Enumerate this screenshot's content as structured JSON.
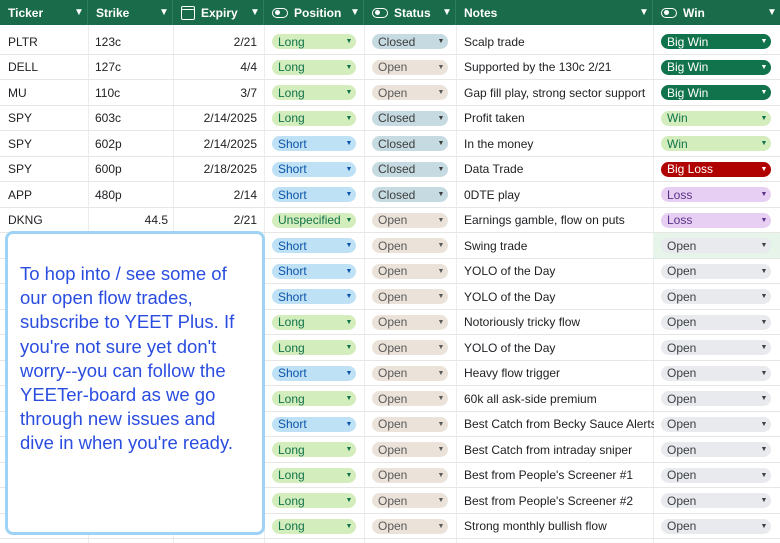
{
  "columns": [
    {
      "label": "Ticker"
    },
    {
      "label": "Strike"
    },
    {
      "label": "Expiry"
    },
    {
      "label": "Position"
    },
    {
      "label": "Status"
    },
    {
      "label": "Notes"
    },
    {
      "label": "Win"
    }
  ],
  "rows": [
    {
      "ticker": "PLTR",
      "strike": "123c",
      "mid": "",
      "expiry": "2/21",
      "position": "Long",
      "status": "Closed",
      "notes": "Scalp trade",
      "win": "Big Win"
    },
    {
      "ticker": "DELL",
      "strike": "127c",
      "mid": "",
      "expiry": "4/4",
      "position": "Long",
      "status": "Open",
      "notes": "Supported by the 130c 2/21",
      "win": "Big Win"
    },
    {
      "ticker": "MU",
      "strike": "110c",
      "mid": "",
      "expiry": "3/7",
      "position": "Long",
      "status": "Open",
      "notes": "Gap fill play, strong sector support",
      "win": "Big Win"
    },
    {
      "ticker": "SPY",
      "strike": "603c",
      "mid": "",
      "expiry": "2/14/2025",
      "position": "Long",
      "status": "Closed",
      "notes": "Profit taken",
      "win": "Win"
    },
    {
      "ticker": "SPY",
      "strike": "602p",
      "mid": "",
      "expiry": "2/14/2025",
      "position": "Short",
      "status": "Closed",
      "notes": "In the money",
      "win": "Win"
    },
    {
      "ticker": "SPY",
      "strike": "600p",
      "mid": "",
      "expiry": "2/18/2025",
      "position": "Short",
      "status": "Closed",
      "notes": "Data Trade",
      "win": "Big Loss"
    },
    {
      "ticker": "APP",
      "strike": "480p",
      "mid": "",
      "expiry": "2/14",
      "position": "Short",
      "status": "Closed",
      "notes": "0DTE  play",
      "win": "Loss"
    },
    {
      "ticker": "DKNG",
      "strike": "",
      "mid": "44.5",
      "expiry": "2/21",
      "position": "Unspecified",
      "status": "Open",
      "notes": "Earnings gamble, flow on puts",
      "win": "Loss"
    },
    {
      "ticker": "",
      "strike": "",
      "mid": "",
      "expiry": "",
      "position": "Short",
      "status": "Open",
      "notes": "Swing trade",
      "win": "Open"
    },
    {
      "ticker": "",
      "strike": "",
      "mid": "",
      "expiry": "",
      "position": "Short",
      "status": "Open",
      "notes": "YOLO of the Day",
      "win": "Open"
    },
    {
      "ticker": "",
      "strike": "",
      "mid": "",
      "expiry": "",
      "position": "Short",
      "status": "Open",
      "notes": "YOLO of the Day",
      "win": "Open"
    },
    {
      "ticker": "",
      "strike": "",
      "mid": "",
      "expiry": "",
      "position": "Long",
      "status": "Open",
      "notes": "Notoriously tricky flow",
      "win": "Open"
    },
    {
      "ticker": "",
      "strike": "",
      "mid": "",
      "expiry": "",
      "position": "Long",
      "status": "Open",
      "notes": "YOLO of the Day",
      "win": "Open"
    },
    {
      "ticker": "",
      "strike": "",
      "mid": "",
      "expiry": "",
      "position": "Short",
      "status": "Open",
      "notes": "Heavy flow trigger",
      "win": "Open"
    },
    {
      "ticker": "",
      "strike": "",
      "mid": "",
      "expiry": "",
      "position": "Long",
      "status": "Open",
      "notes": "60k all ask-side premium",
      "win": "Open"
    },
    {
      "ticker": "",
      "strike": "",
      "mid": "",
      "expiry": "",
      "position": "Short",
      "status": "Open",
      "notes": "Best Catch from Becky Sauce Alerts",
      "win": "Open"
    },
    {
      "ticker": "",
      "strike": "",
      "mid": "",
      "expiry": "",
      "position": "Long",
      "status": "Open",
      "notes": "Best Catch from intraday sniper",
      "win": "Open"
    },
    {
      "ticker": "",
      "strike": "",
      "mid": "",
      "expiry": "",
      "position": "Long",
      "status": "Open",
      "notes": "Best from People's Screener #1",
      "win": "Open"
    },
    {
      "ticker": "",
      "strike": "",
      "mid": "",
      "expiry": "",
      "position": "Long",
      "status": "Open",
      "notes": "Best from People's Screener #2",
      "win": "Open"
    },
    {
      "ticker": "",
      "strike": "",
      "mid": "",
      "expiry": "",
      "position": "Long",
      "status": "Open",
      "notes": "Strong monthly bullish flow",
      "win": "Open"
    }
  ],
  "overlay": {
    "text": "To hop into / see some of our open flow trades, subscribe to YEET Plus. If you're not sure yet don't worry--you can follow the YEETer-board as we go through new issues and dive in when you're ready."
  },
  "colors": {
    "header_bg": "#1a6b4a",
    "overlay_text": "#2a4de0",
    "overlay_border": "#9fd3f5",
    "big_win": "#11734b",
    "big_loss": "#b10202"
  },
  "icons": {
    "expiry": "calendar-icon",
    "position": "toggle-icon",
    "status": "toggle-icon",
    "win": "toggle-icon",
    "chevron": "chevron-down-icon",
    "dropdown": "caret-down-icon"
  }
}
